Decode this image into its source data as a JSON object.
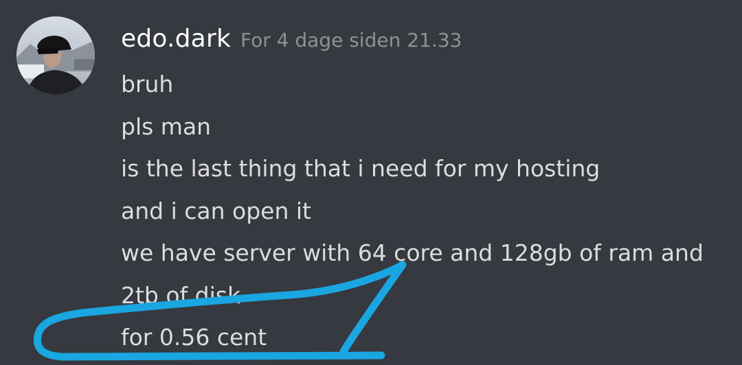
{
  "message": {
    "username": "edo.dark",
    "timestamp": "For 4 dage siden 21.33",
    "avatar_icon": "user-avatar-photo",
    "lines": [
      "bruh",
      "pls man",
      "is the last thing that i need for my hosting",
      "and i can open it",
      "we have server with 64 core and 128gb of ram and",
      "2tb of disk",
      "for 0.56 cent"
    ]
  },
  "colors": {
    "background": "#36393f",
    "username": "#ffffff",
    "timestamp": "#8e9297",
    "text": "#dcddde",
    "annotation": "#1aa6e0"
  }
}
